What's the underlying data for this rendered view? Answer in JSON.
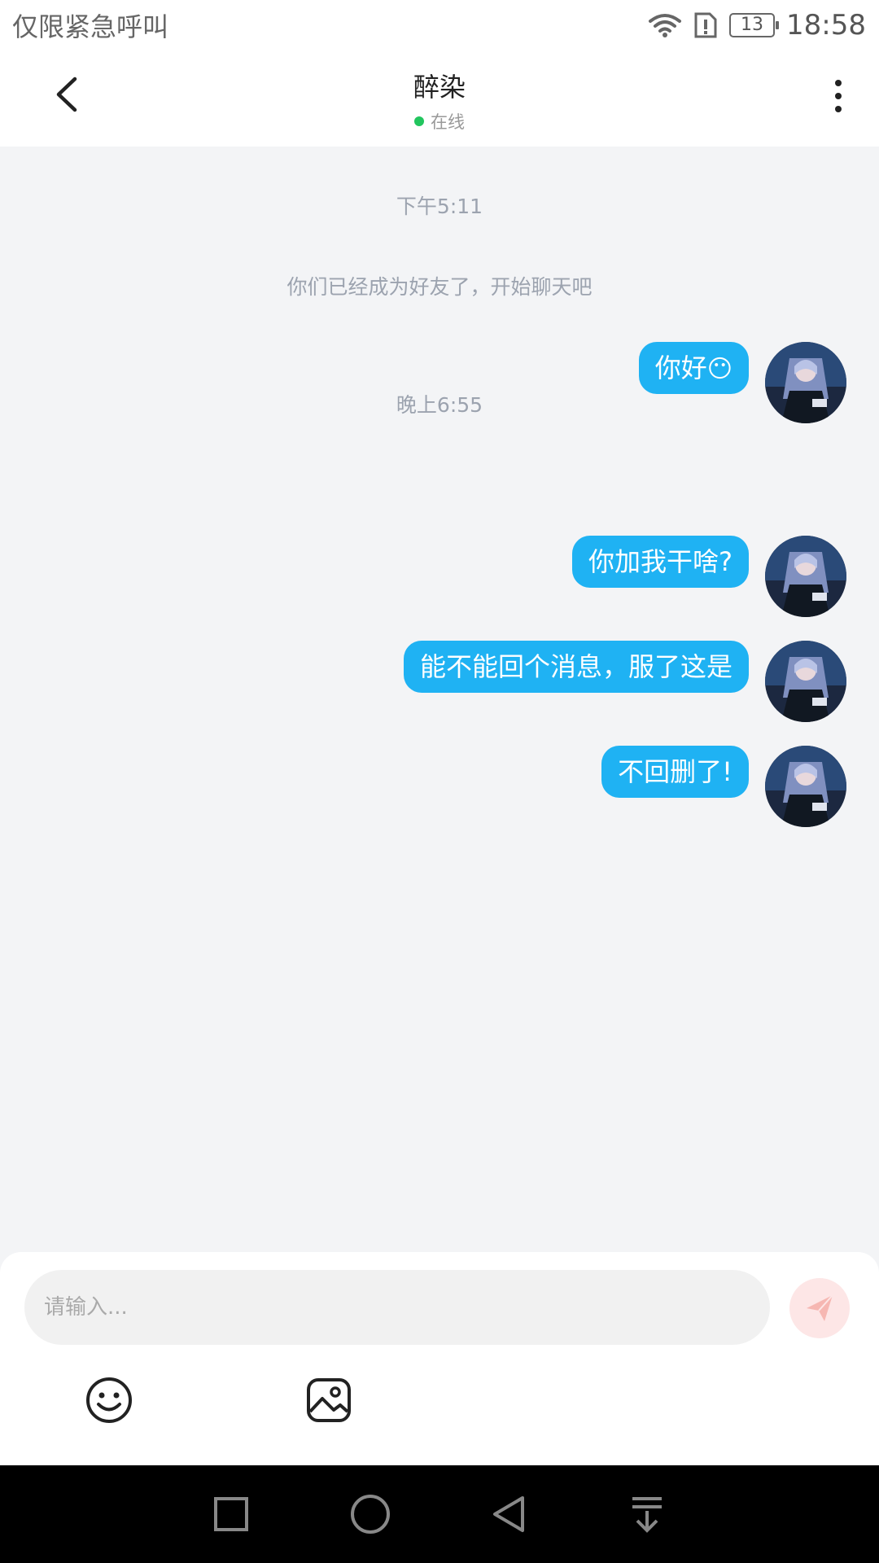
{
  "status_bar": {
    "left_text": "仅限紧急呼叫",
    "battery": "13",
    "time": "18:58"
  },
  "header": {
    "title": "醉染",
    "status": "在线"
  },
  "chat": {
    "time_1": "下午5:11",
    "system_message": "你们已经成为好友了，开始聊天吧",
    "msg_1": "你好",
    "msg_1_emoji": "😶",
    "time_2": "晚上6:55",
    "msg_2": "你加我干啥?",
    "msg_3": "能不能回个消息，服了这是",
    "msg_4": "不回删了!"
  },
  "input": {
    "placeholder": "请输入..."
  },
  "colors": {
    "bubble": "#1fb2f3",
    "online": "#22c55e",
    "send_disabled": "#fde6e6"
  }
}
